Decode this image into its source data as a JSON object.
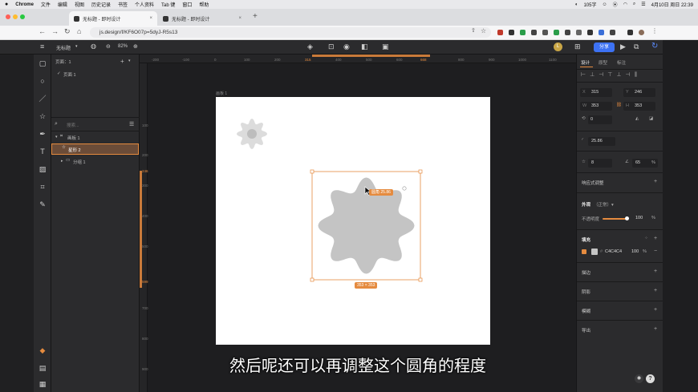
{
  "menubar": {
    "app": "Chrome",
    "items": [
      "文件",
      "编辑",
      "视图",
      "历史记录",
      "书签",
      "个人资料",
      "Tab 键",
      "窗口",
      "帮助"
    ],
    "word_count": "105字",
    "datetime": "4月10日 周日 22:39"
  },
  "browser": {
    "tabs": [
      {
        "label": "无标题 - 即时设计"
      },
      {
        "label": "无标题 - 即时设计"
      }
    ],
    "url": "js.design/f/KF6O07p=5dyJ-R5s13",
    "new_tab": "+"
  },
  "toolbar": {
    "file_name": "无标题",
    "zoom": "82%",
    "share_label": "分享",
    "avatar": "L"
  },
  "layers": {
    "page_label": "页面：1",
    "page_item": "页面 1",
    "search_placeholder": "搜索...",
    "items": [
      {
        "label": "画板 1"
      },
      {
        "label": "星形 2"
      },
      {
        "label": "分组 1"
      }
    ]
  },
  "canvas": {
    "board_label": "画板 1",
    "ruler_h": [
      "-200",
      "-100",
      "0",
      "100",
      "200",
      "315",
      "400",
      "500",
      "600",
      "668",
      "800",
      "900",
      "1000",
      "1100"
    ],
    "ruler_v": [
      "100",
      "200",
      "246",
      "300",
      "400",
      "500",
      "599",
      "700",
      "800",
      "900"
    ],
    "corner_badge": "圆角 25.86",
    "size_badge": "353 × 353",
    "shape_color": "#C4C4C4",
    "accent": "#E58B3F"
  },
  "inspector": {
    "tabs": [
      "设计",
      "原型",
      "标注"
    ],
    "x": "315",
    "y": "246",
    "w": "353",
    "h": "353",
    "rotation": "0",
    "radius": "25.86",
    "points": "8",
    "ratio": "65",
    "ratio_unit": "%",
    "responsive": "响应式调整",
    "appearance": "外观",
    "blend": "正常",
    "opacity_label": "不透明度",
    "opacity": "100",
    "opacity_unit": "%",
    "fill_title": "填充",
    "fill_hex": "C4C4C4",
    "fill_opacity": "100",
    "sections": [
      "描边",
      "阴影",
      "模糊",
      "导出"
    ]
  },
  "subtitle": "然后呢还可以再调整这个圆角的程度"
}
